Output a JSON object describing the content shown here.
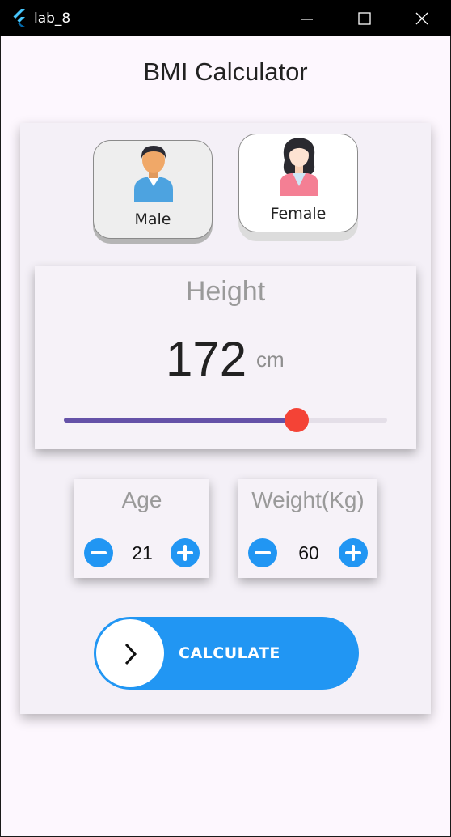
{
  "window": {
    "title": "lab_8"
  },
  "app": {
    "title": "BMI Calculator"
  },
  "gender": {
    "male_label": "Male",
    "female_label": "Female"
  },
  "height": {
    "label": "Height",
    "value": "172",
    "unit": "cm",
    "slider_fraction": 0.72
  },
  "age": {
    "label": "Age",
    "value": "21"
  },
  "weight": {
    "label": "Weight(Kg)",
    "value": "60"
  },
  "calculate": {
    "label": "CALCULATE"
  },
  "colors": {
    "accent": "#2196f3",
    "slider_active": "#6552a8",
    "slider_thumb": "#f44336"
  }
}
